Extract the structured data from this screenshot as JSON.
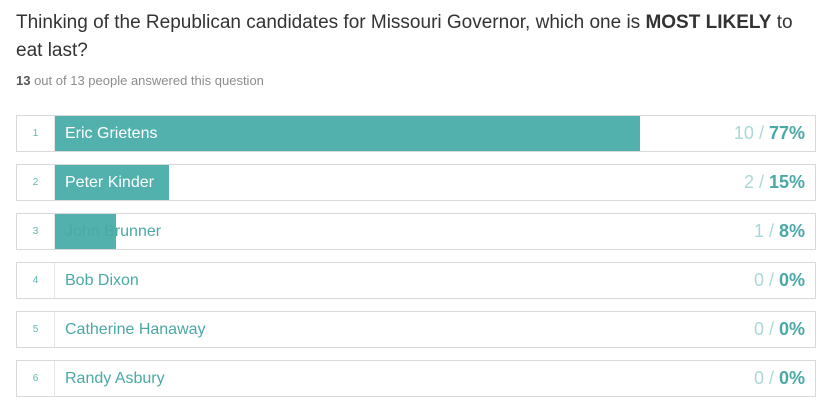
{
  "question": {
    "text_before": "Thinking of the Republican candidates for Missouri Governor, which one is ",
    "emphasis": "MOST LIKELY",
    "text_after": " to eat last?"
  },
  "answered": {
    "count": "13",
    "text": " out of 13 people answered this question"
  },
  "results": [
    {
      "index": "1",
      "name": "Eric Grietens",
      "count": "10",
      "sep": " / ",
      "percent": "77%",
      "fraction": 0.77
    },
    {
      "index": "2",
      "name": "Peter Kinder",
      "count": "2",
      "sep": " / ",
      "percent": "15%",
      "fraction": 0.15
    },
    {
      "index": "3",
      "name": "John Brunner",
      "count": "1",
      "sep": " / ",
      "percent": "8%",
      "fraction": 0.08
    },
    {
      "index": "4",
      "name": "Bob Dixon",
      "count": "0",
      "sep": " / ",
      "percent": "0%",
      "fraction": 0
    },
    {
      "index": "5",
      "name": "Catherine Hanaway",
      "count": "0",
      "sep": " / ",
      "percent": "0%",
      "fraction": 0
    },
    {
      "index": "6",
      "name": "Randy Asbury",
      "count": "0",
      "sep": " / ",
      "percent": "0%",
      "fraction": 0
    }
  ],
  "colors": {
    "bar": "#52b1ad",
    "accent_text": "#4aa9a6",
    "count_text": "#a9d9d6",
    "label_on_bar": "#ffffff"
  }
}
